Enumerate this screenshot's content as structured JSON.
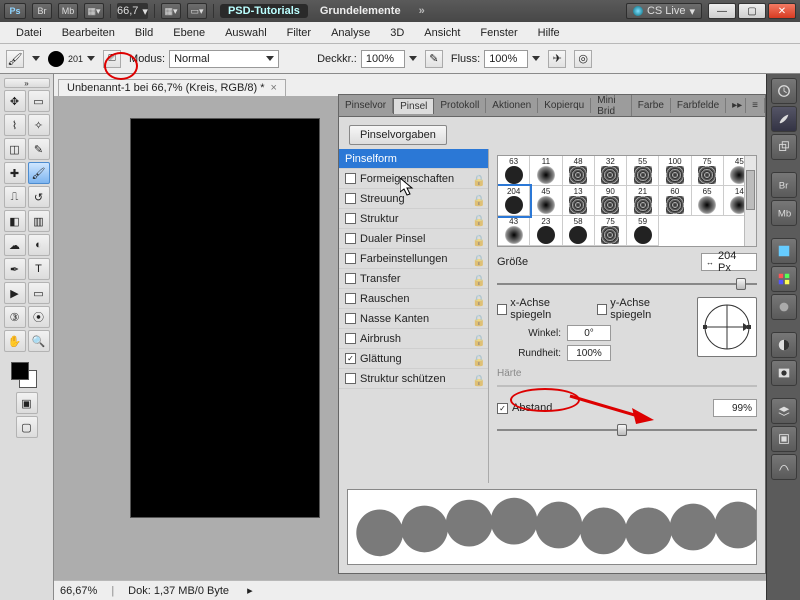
{
  "appbar": {
    "ps": "Ps",
    "br": "Br",
    "mb": "Mb",
    "zoom_display": "66,7",
    "dropdown_arrow": "▾",
    "expand": "»",
    "title_pill": "PSD-Tutorials",
    "title2": "Grundelemente",
    "cslive": "CS Live"
  },
  "menu": [
    "Datei",
    "Bearbeiten",
    "Bild",
    "Ebene",
    "Auswahl",
    "Filter",
    "Analyse",
    "3D",
    "Ansicht",
    "Fenster",
    "Hilfe"
  ],
  "optbar": {
    "brush_size": "201",
    "mode_lbl": "Modus:",
    "mode_val": "Normal",
    "opacity_lbl": "Deckkr.:",
    "opacity_val": "100%",
    "flow_lbl": "Fluss:",
    "flow_val": "100%"
  },
  "doctab": "Unbenannt-1 bei 66,7% (Kreis, RGB/8) *",
  "panel": {
    "tabs": [
      "Pinselvor",
      "Pinsel",
      "Protokoll",
      "Aktionen",
      "Kopierqu",
      "Mini Brid",
      "Farbe",
      "Farbfelde"
    ],
    "active_tab": 1,
    "preset_btn": "Pinselvorgaben",
    "left": {
      "header": "Pinselform",
      "items": [
        {
          "chk": false,
          "label": "Formeigenschaften",
          "lock": true
        },
        {
          "chk": false,
          "label": "Streuung",
          "lock": true
        },
        {
          "chk": false,
          "label": "Struktur",
          "lock": true
        },
        {
          "chk": false,
          "label": "Dualer Pinsel",
          "lock": true
        },
        {
          "chk": false,
          "label": "Farbeinstellungen",
          "lock": true
        },
        {
          "chk": false,
          "label": "Transfer",
          "lock": true
        },
        {
          "chk": false,
          "label": "Rauschen",
          "lock": true
        },
        {
          "chk": false,
          "label": "Nasse Kanten",
          "lock": true
        },
        {
          "chk": false,
          "label": "Airbrush",
          "lock": true
        },
        {
          "chk": true,
          "label": "Glättung",
          "lock": true
        },
        {
          "chk": false,
          "label": "Struktur schützen",
          "lock": true
        }
      ]
    },
    "brush_sizes": [
      "63",
      "11",
      "48",
      "32",
      "55",
      "100",
      "75",
      "45",
      "204",
      "45",
      "13",
      "90",
      "21",
      "60",
      "65",
      "14",
      "43",
      "23",
      "58",
      "75",
      "59"
    ],
    "selected_brush_index": 8,
    "size_lbl": "Größe",
    "size_val": "204 Px",
    "mirror_x": "x-Achse spiegeln",
    "mirror_y": "y-Achse spiegeln",
    "angle_lbl": "Winkel:",
    "angle_val": "0°",
    "round_lbl": "Rundheit:",
    "round_val": "100%",
    "haerte_lbl": "Härte",
    "abstand_lbl": "Abstand",
    "abstand_chk": true,
    "abstand_val": "99%"
  },
  "status": {
    "zoom": "66,67%",
    "doc": "Dok: 1,37 MB/0 Byte"
  }
}
